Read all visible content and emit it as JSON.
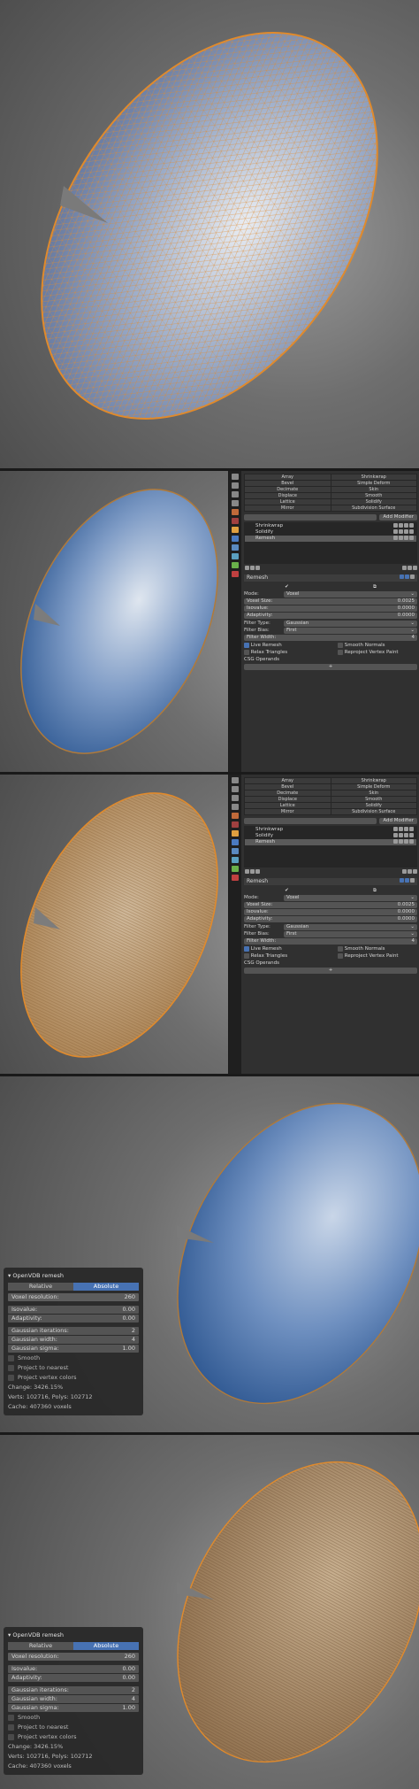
{
  "modifier_menu": {
    "left": [
      "Array",
      "Bevel",
      "Decimate",
      "Displace",
      "Lattice",
      "Mirror"
    ],
    "right": [
      "Shrinkwrap",
      "Simple Deform",
      "Skin",
      "Smooth",
      "Solidify",
      "Subdivision Surface"
    ],
    "add_modifier": "Add Modifier"
  },
  "stack": [
    "Shrinkwrap",
    "Solidify",
    "Remesh"
  ],
  "remesh": {
    "name": "Remesh",
    "mode_label": "Mode:",
    "mode_value": "Voxel",
    "voxel_size_label": "Voxel Size:",
    "voxel_size_value": "0.0025",
    "isovalue_label": "Isovalue:",
    "isovalue_value": "0.0000",
    "adaptivity_label": "Adaptivity:",
    "adaptivity_value": "0.0000",
    "filter_type_label": "Filter Type:",
    "filter_type_value": "Gaussian",
    "filter_bias_label": "Filter Bias:",
    "filter_bias_value": "First",
    "filter_width_label": "Filter Width:",
    "filter_width_value": "4",
    "live_remesh": "Live Remesh",
    "smooth_normals": "Smooth Normals",
    "relax_triangles": "Relax Triangles",
    "reproject_vertex_paint": "Reproject Vertex Paint",
    "csg_operands": "CSG Operands",
    "plus": "+"
  },
  "operator": {
    "title": "OpenVDB remesh",
    "tab_relative": "Relative",
    "tab_absolute": "Absolute",
    "voxel_resolution_label": "Voxel resolution:",
    "voxel_resolution_value": "260",
    "isovalue_label": "Isovalue:",
    "isovalue_value": "0.00",
    "adaptivity_label": "Adaptivity:",
    "adaptivity_value": "0.00",
    "gaussian_iterations_label": "Gaussian iterations:",
    "gaussian_iterations_value": "2",
    "gaussian_width_label": "Gaussian width:",
    "gaussian_width_value": "4",
    "gaussian_sigma_label": "Gaussian sigma:",
    "gaussian_sigma_value": "1.00",
    "smooth": "Smooth",
    "project_nearest": "Project to nearest",
    "project_vertex_colors": "Project vertex colors",
    "change": "Change: 3426.15%",
    "verts_polys": "Verts: 102716, Polys: 102712",
    "cache": "Cache: 407360 voxels"
  },
  "colors": {
    "accent": "#4772b3",
    "wire_orange": "#e08a2c",
    "mesh_blue": "#2f5fa0",
    "mesh_tan": "#b08a60"
  }
}
